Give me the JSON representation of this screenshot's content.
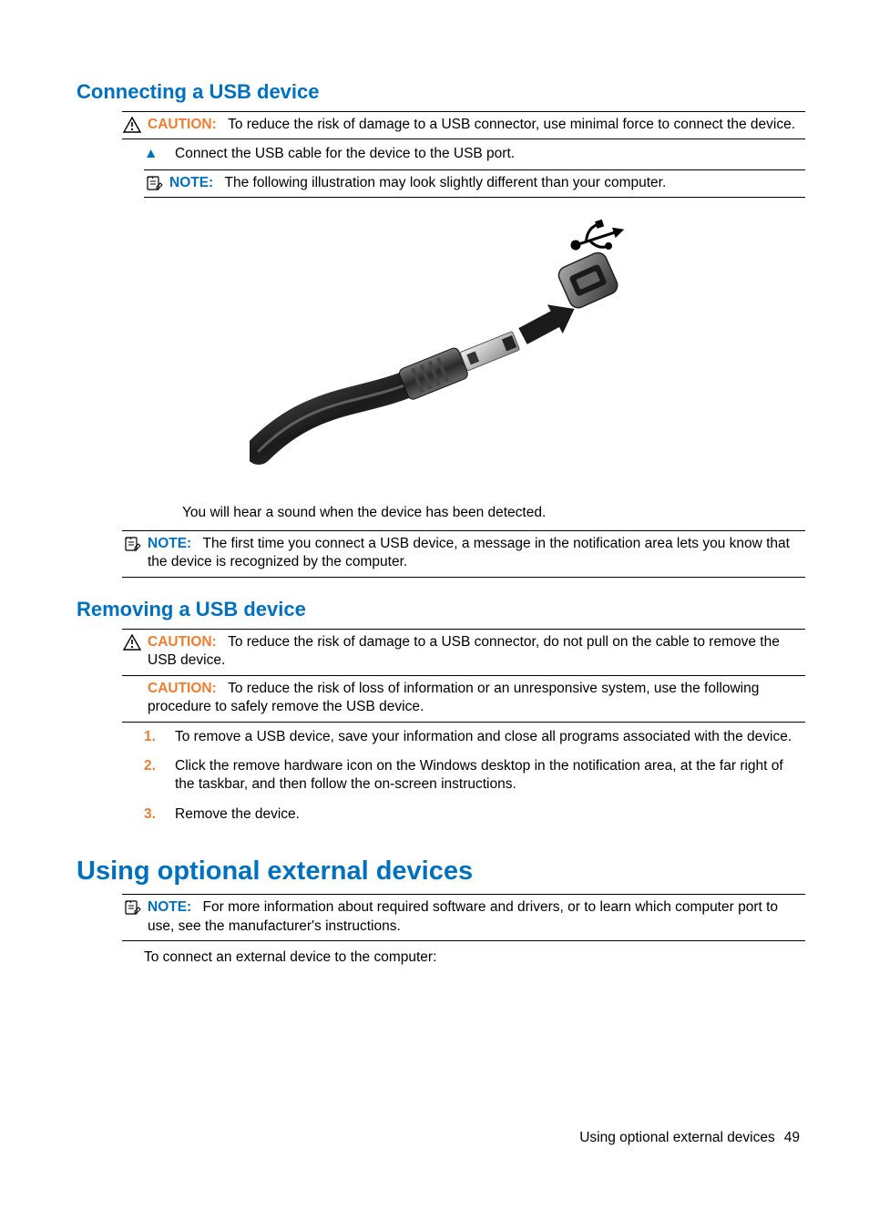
{
  "heading_connect": "Connecting a USB device",
  "caution1": {
    "label": "CAUTION:",
    "text": "To reduce the risk of damage to a USB connector, use minimal force to connect the device."
  },
  "step_connect": "Connect the USB cable for the device to the USB port.",
  "note1": {
    "label": "NOTE:",
    "text": "The following illustration may look slightly different than your computer."
  },
  "detected_text": "You will hear a sound when the device has been detected.",
  "note2": {
    "label": "NOTE:",
    "text": "The first time you connect a USB device, a message in the notification area lets you know that the device is recognized by the computer."
  },
  "heading_remove": "Removing a USB device",
  "caution2": {
    "label": "CAUTION:",
    "text": "To reduce the risk of damage to a USB connector, do not pull on the cable to remove the USB device."
  },
  "caution3": {
    "label": "CAUTION:",
    "text": "To reduce the risk of loss of information or an unresponsive system, use the following procedure to safely remove the USB device."
  },
  "remove_steps": [
    {
      "num": "1.",
      "text": "To remove a USB device, save your information and close all programs associated with the device."
    },
    {
      "num": "2.",
      "text": "Click the remove hardware icon on the Windows desktop in the notification area, at the far right of the taskbar, and then follow the on-screen instructions."
    },
    {
      "num": "3.",
      "text": "Remove the device."
    }
  ],
  "heading_external": "Using optional external devices",
  "note3": {
    "label": "NOTE:",
    "text": "For more information about required software and drivers, or to learn which computer port to use, see the manufacturer's instructions."
  },
  "external_intro": "To connect an external device to the computer:",
  "footer_text": "Using optional external devices",
  "page_number": "49"
}
